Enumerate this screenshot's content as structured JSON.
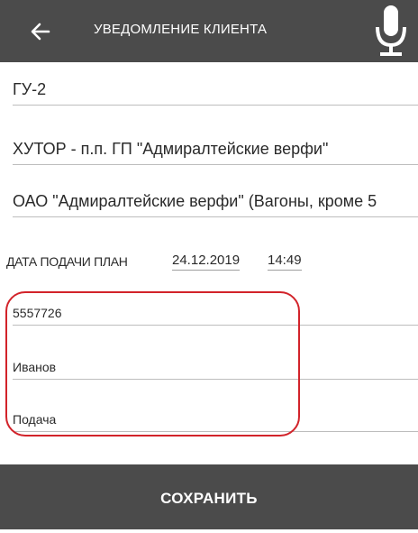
{
  "appbar": {
    "title": "УВЕДОМЛЕНИЕ КЛИЕНТА",
    "back_icon": "arrow-left-icon",
    "mic_icon": "microphone-icon",
    "background": "#4b4b4b"
  },
  "form": {
    "field_1": "ГУ-2",
    "field_2": "ХУТОР - п.п. ГП \"Адмиралтейские верфи\"",
    "field_3": "ОАО \"Адмиралтейские верфи\" (Вагоны, кроме 5",
    "date_label": "ДАТА ПОДАЧИ ПЛАН",
    "date_value": "24.12.2019",
    "time_value": "14:49",
    "field_4": "5557726",
    "field_5": "Иванов",
    "field_6": "Подача"
  },
  "highlight_color": "#d2232a",
  "save_label": "СОХРАНИТЬ"
}
